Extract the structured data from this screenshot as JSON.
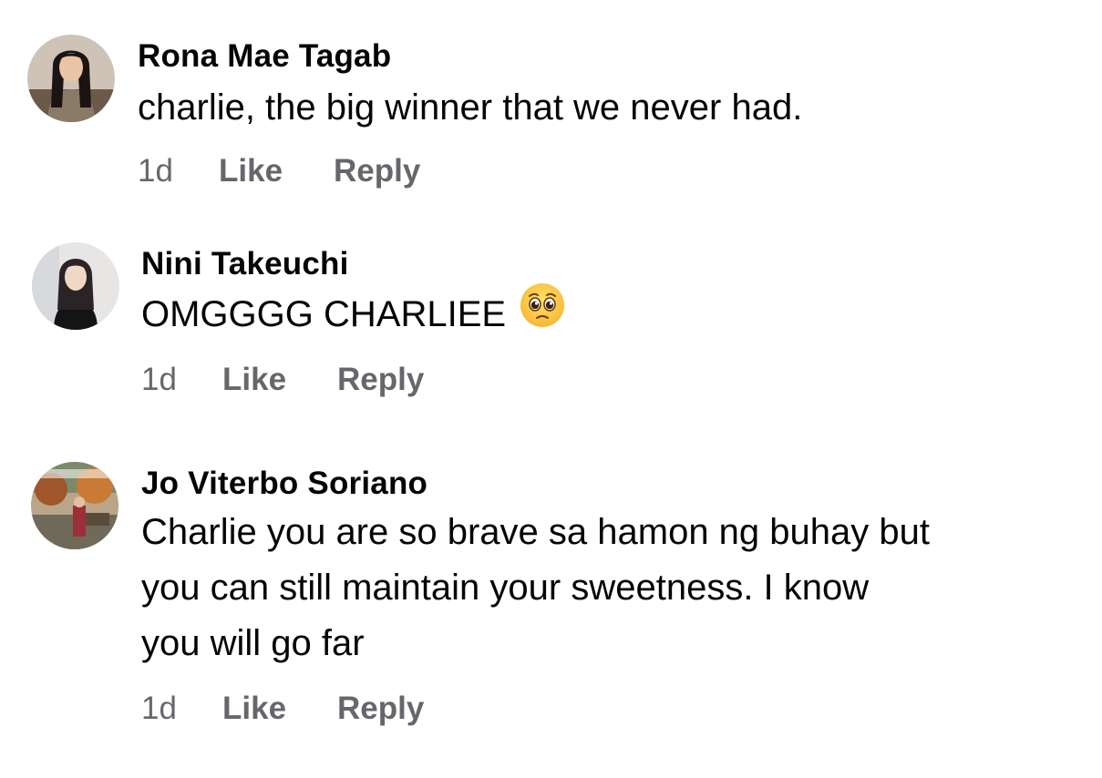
{
  "comments": [
    {
      "author": "Rona Mae Tagab",
      "lines": [
        "charlie, the big winner that we never had."
      ],
      "time": "1d",
      "like_label": "Like",
      "reply_label": "Reply"
    },
    {
      "author": "Nini Takeuchi",
      "lines": [
        "OMGGGG CHARLIEE"
      ],
      "emoji_icon": "pleading-face-icon",
      "time": "1d",
      "like_label": "Like",
      "reply_label": "Reply"
    },
    {
      "author": "Jo Viterbo Soriano",
      "lines": [
        "Charlie you are so brave sa hamon ng buhay but",
        "you can  still maintain your sweetness. I know",
        "you will go far"
      ],
      "time": "1d",
      "like_label": "Like",
      "reply_label": "Reply"
    }
  ],
  "colors": {
    "text": "#050505",
    "meta": "#65676b",
    "background": "#ffffff"
  }
}
